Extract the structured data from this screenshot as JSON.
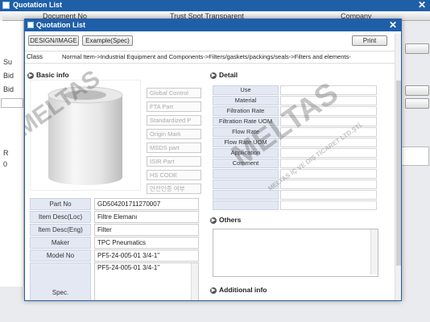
{
  "outer": {
    "title": "Quotation List",
    "close": "✕",
    "header": {
      "col1": "Document No",
      "col2": "Trust  Spot  Transparent",
      "col3": "Company"
    },
    "left_labels": [
      "Su",
      "Bid",
      "Bid",
      "R",
      "0"
    ]
  },
  "modal": {
    "title": "Quotation List",
    "close": "✕",
    "toolbar": {
      "design_image": "DESIGN/IMAGE",
      "example_spec": "Example(Spec)",
      "print": "Print"
    },
    "class_label": "Class",
    "class_value": "Normal Item->Industrial Equipment and Components->Filters/gaskets/packings/seals->Filters and elements-",
    "basic_info_title": "Basic info",
    "detail_title": "Detail",
    "others_title": "Others",
    "additional_title": "Additional info",
    "side_buttons": [
      "Global Control",
      "FTA Part",
      "Standardized P",
      "Origin Mark",
      "MSDS part",
      "ISIR Part",
      "HS CODE",
      "안전인증 여부"
    ],
    "basic": [
      {
        "label": "Part No",
        "value": "GD504201711270007"
      },
      {
        "label": "Item Desc(Loc)",
        "value": "Filtre Elemanı"
      },
      {
        "label": "Item Desc(Eng)",
        "value": "Filter"
      },
      {
        "label": "Maker",
        "value": "TPC Pneumatics"
      },
      {
        "label": "Model No",
        "value": "PF5-24-005-01  3/4-1\""
      }
    ],
    "spec_label": "Spec.",
    "spec_value": "PF5-24-005-01  3/4-1\"",
    "detail_rows": [
      "Use",
      "Material",
      "Filtration Rate",
      "Filtration Rate UOM",
      "Flow Rate",
      "Flow Rate UOM",
      "Application",
      "Comment",
      "",
      "",
      "",
      ""
    ],
    "watermark": {
      "big": "MELTAS",
      "small": "MELTAS İÇ VE DIŞ TİCARET LTD.ŞTİ."
    }
  }
}
